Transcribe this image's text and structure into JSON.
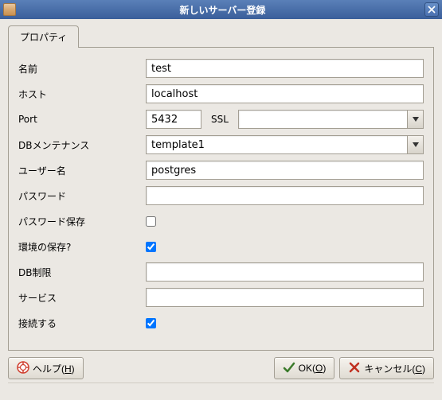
{
  "window": {
    "title": "新しいサーバー登録"
  },
  "tabs": {
    "property": "プロパティ"
  },
  "form": {
    "name_label": "名前",
    "name_value": "test",
    "host_label": "ホスト",
    "host_value": "localhost",
    "port_label": "Port",
    "port_value": "5432",
    "ssl_label": "SSL",
    "ssl_value": "",
    "dbmaint_label": "DBメンテナンス",
    "dbmaint_value": "template1",
    "user_label": "ユーザー名",
    "user_value": "postgres",
    "password_label": "パスワード",
    "password_value": "",
    "savepw_label": "パスワード保存",
    "savepw_checked": false,
    "saveenv_label": "環境の保存?",
    "saveenv_checked": true,
    "dblimit_label": "DB制限",
    "dblimit_value": "",
    "service_label": "サービス",
    "service_value": "",
    "connect_label": "接続する",
    "connect_checked": true
  },
  "buttons": {
    "help": "ヘルプ(",
    "help_key": "H",
    "help_suffix": ")",
    "ok": "OK(",
    "ok_key": "O",
    "ok_suffix": ")",
    "cancel": "キャンセル(",
    "cancel_key": "C",
    "cancel_suffix": ")"
  }
}
